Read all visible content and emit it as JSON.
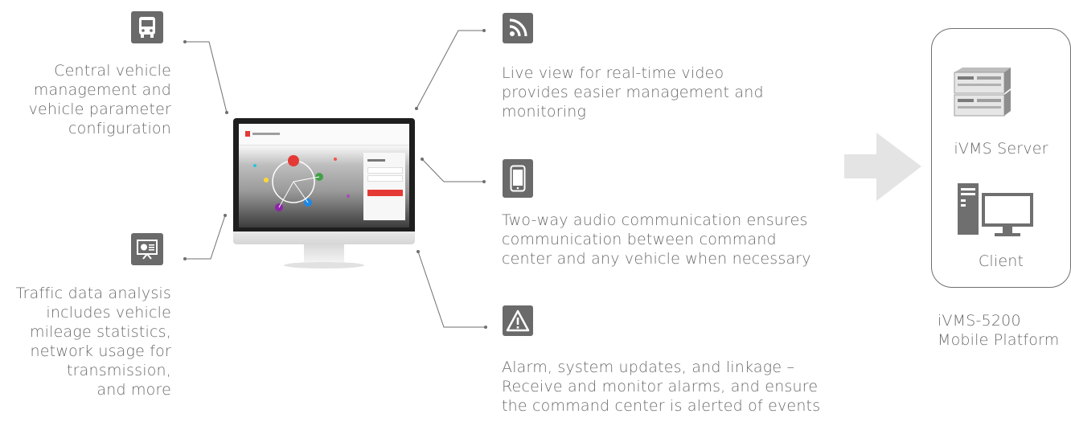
{
  "features": {
    "vehicle": {
      "icon": "bus-icon",
      "text": [
        "Central vehicle",
        "management and",
        "vehicle parameter",
        "configuration"
      ]
    },
    "traffic": {
      "icon": "presentation-chart-icon",
      "text": [
        "Traffic data analysis",
        "includes vehicle",
        "mileage statistics,",
        "network usage for",
        "transmission,",
        "and more"
      ]
    },
    "live_view": {
      "icon": "rss-feed-icon",
      "text": [
        "Live view for real-time video",
        "provides easier management and",
        "monitoring"
      ]
    },
    "audio": {
      "icon": "smartphone-icon",
      "text": [
        "Two-way audio communication ensures",
        "communication between command",
        "center and any vehicle when necessary"
      ]
    },
    "alarm": {
      "icon": "warning-icon",
      "text": [
        "Alarm, system updates, and linkage –",
        "Receive and monitor alarms, and ensure",
        "the command center is alerted of events"
      ]
    }
  },
  "platform": {
    "server_label": "iVMS Server",
    "client_label": "Client",
    "caption": [
      "iVMS-5200",
      "Mobile Platform"
    ]
  },
  "colors": {
    "icon_bg": "#6a6a6a",
    "text": "#6b6b6b",
    "arrow": "#e4e4e4",
    "line": "#6f6f6f"
  }
}
